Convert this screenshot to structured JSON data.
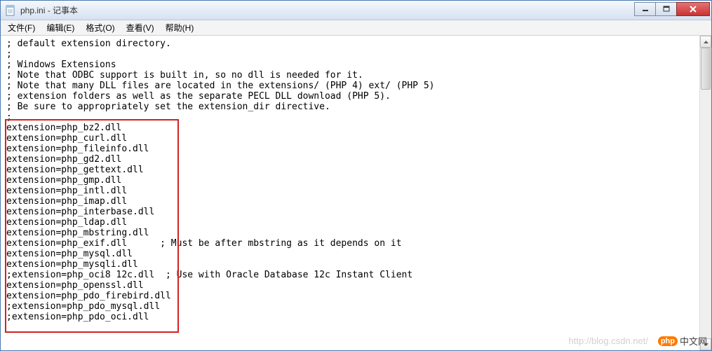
{
  "window": {
    "title": "php.ini - 记事本"
  },
  "menu": {
    "file": "文件(F)",
    "edit": "编辑(E)",
    "format": "格式(O)",
    "view": "查看(V)",
    "help": "帮助(H)"
  },
  "lines": {
    "l0": "; default extension directory.",
    "l1": ";",
    "l2": "; Windows Extensions",
    "l3": "; Note that ODBC support is built in, so no dll is needed for it.",
    "l4": "; Note that many DLL files are located in the extensions/ (PHP 4) ext/ (PHP 5)",
    "l5": "; extension folders as well as the separate PECL DLL download (PHP 5).",
    "l6": "; Be sure to appropriately set the extension_dir directive.",
    "l7": ";",
    "l8": "extension=php_bz2.dll",
    "l9": "extension=php_curl.dll",
    "l10": "extension=php_fileinfo.dll",
    "l11": "extension=php_gd2.dll",
    "l12": "extension=php_gettext.dll",
    "l13": "extension=php_gmp.dll",
    "l14": "extension=php_intl.dll",
    "l15": "extension=php_imap.dll",
    "l16": "extension=php_interbase.dll",
    "l17": "extension=php_ldap.dll",
    "l18": "extension=php_mbstring.dll",
    "l19": "extension=php_exif.dll      ; Must be after mbstring as it depends on it",
    "l20": "extension=php_mysql.dll",
    "l21": "extension=php_mysqli.dll",
    "l22": ";extension=php_oci8 12c.dll  ; Use with Oracle Database 12c Instant Client",
    "l23": "extension=php_openssl.dll",
    "l24": "extension=php_pdo_firebird.dll",
    "l25": ";extension=php_pdo_mysql.dll",
    "l26": ";extension=php_pdo_oci.dll"
  },
  "watermark": {
    "url": "http://blog.csdn.net/",
    "badge": "php",
    "site": "中文网"
  }
}
